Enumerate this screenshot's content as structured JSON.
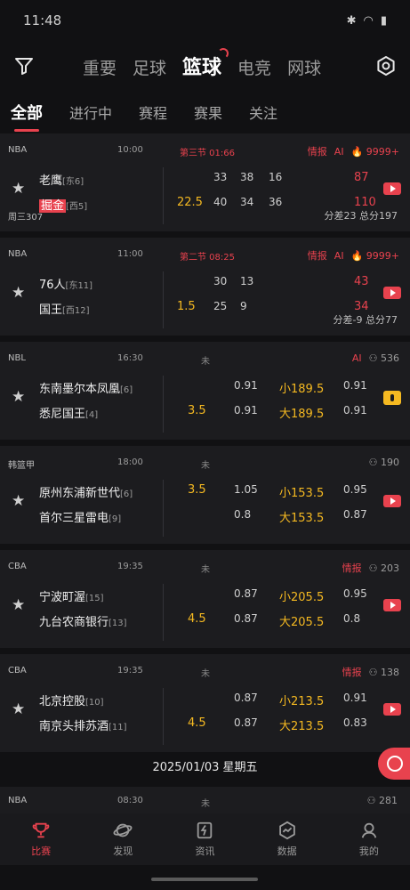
{
  "status": {
    "time": "11:48",
    "icons": [
      "bluetooth-icon",
      "wifi-icon",
      "battery-icon"
    ]
  },
  "sports": [
    "重要",
    "足球",
    "篮球",
    "电竞",
    "网球"
  ],
  "active_sport": "篮球",
  "subtabs": [
    "全部",
    "进行中",
    "赛程",
    "赛果",
    "关注"
  ],
  "active_subtab": "全部",
  "matches": [
    {
      "league": "NBA",
      "time": "10:00",
      "state": "第三节 01:66",
      "state_live": true,
      "tags": [
        "情报",
        "AI"
      ],
      "hot": "9999+",
      "team1": {
        "name": "老鹰",
        "rank": "[东6]"
      },
      "team2": {
        "name": "掘金",
        "rank": "[西5]"
      },
      "handicap": "22.5",
      "q1": [
        "33",
        "40"
      ],
      "q2": [
        "38",
        "34"
      ],
      "q3": [
        "16",
        "36"
      ],
      "total": [
        "87",
        "110"
      ],
      "foot_left": "周三307",
      "foot_right": "分差23    总分197",
      "media": "video"
    },
    {
      "league": "NBA",
      "time": "11:00",
      "state": "第二节 08:25",
      "state_live": true,
      "tags": [
        "情报",
        "AI"
      ],
      "hot": "9999+",
      "team1": {
        "name": "76人",
        "rank": "[东11]"
      },
      "team2": {
        "name": "国王",
        "rank": "[西12]"
      },
      "handicap": "1.5",
      "q1": [
        "30",
        "25"
      ],
      "q2": [
        "13",
        "9"
      ],
      "total": [
        "43",
        "34"
      ],
      "foot_left": "",
      "foot_right": "分差-9    总分77",
      "media": "video"
    },
    {
      "league": "NBL",
      "time": "16:30",
      "state": "未",
      "state_live": false,
      "tags": [
        "AI"
      ],
      "count": "536",
      "team1": {
        "name": "东南墨尔本凤凰",
        "rank": "[6]"
      },
      "team2": {
        "name": "悉尼国王",
        "rank": "[4]"
      },
      "handicap": "3.5",
      "odds1": [
        "0.91",
        "0.91"
      ],
      "ou": [
        "小189.5",
        "大189.5"
      ],
      "odds2": [
        "0.91",
        "0.91"
      ],
      "media": "audio"
    },
    {
      "league": "韩篮甲",
      "time": "18:00",
      "state": "未",
      "state_live": false,
      "tags": [],
      "count": "190",
      "team1": {
        "name": "原州东浦新世代",
        "rank": "[6]"
      },
      "team2": {
        "name": "首尔三星雷电",
        "rank": "[9]"
      },
      "handicap": "3.5",
      "odds1": [
        "1.05",
        "0.8"
      ],
      "ou": [
        "小153.5",
        "大153.5"
      ],
      "odds2": [
        "0.95",
        "0.87"
      ],
      "media": "video"
    },
    {
      "league": "CBA",
      "time": "19:35",
      "state": "未",
      "state_live": false,
      "tags": [
        "情报"
      ],
      "count": "203",
      "team1": {
        "name": "宁波町渥",
        "rank": "[15]"
      },
      "team2": {
        "name": "九台农商银行",
        "rank": "[13]"
      },
      "handicap": "4.5",
      "odds1": [
        "0.87",
        "0.87"
      ],
      "ou": [
        "小205.5",
        "大205.5"
      ],
      "odds2": [
        "0.95",
        "0.8"
      ],
      "media": "video"
    },
    {
      "league": "CBA",
      "time": "19:35",
      "state": "未",
      "state_live": false,
      "tags": [
        "情报"
      ],
      "count": "138",
      "team1": {
        "name": "北京控股",
        "rank": "[10]"
      },
      "team2": {
        "name": "南京头排苏酒",
        "rank": "[11]"
      },
      "handicap": "4.5",
      "odds1": [
        "0.87",
        "0.87"
      ],
      "ou": [
        "小213.5",
        "大213.5"
      ],
      "odds2": [
        "0.91",
        "0.83"
      ],
      "media": "video"
    }
  ],
  "date_separator": "2025/01/03 星期五",
  "peek": {
    "league": "NBA",
    "time": "08:30",
    "state": "未",
    "count": "281"
  },
  "bottom_nav": [
    "比赛",
    "发现",
    "资讯",
    "数据",
    "我的"
  ],
  "active_nav": "比赛",
  "colors": {
    "accent": "#e8424e",
    "odds_yellow": "#f5b921",
    "card_bg": "#1c1c1f",
    "page_bg": "#111113"
  }
}
